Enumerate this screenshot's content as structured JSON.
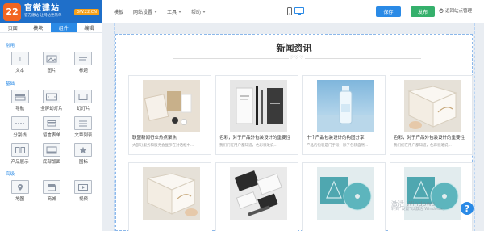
{
  "brand": {
    "logo_text": "22",
    "name": "官微建站",
    "slogan": "官方建站 让网站更简单",
    "site_badge": "GW.22.CN"
  },
  "toolbar": {
    "menu": [
      {
        "label": "模板"
      },
      {
        "label": "网站设置"
      },
      {
        "label": "工具"
      },
      {
        "label": "帮助"
      }
    ],
    "save_label": "保存",
    "publish_label": "发布",
    "back_label": "返回站点管理"
  },
  "sidebar": {
    "tabs": [
      "页面",
      "模块",
      "组件",
      "编辑"
    ],
    "active_tab": "组件",
    "groups": [
      {
        "title": "常用",
        "items": [
          "文本",
          "图片",
          "标题"
        ]
      },
      {
        "title": "基础",
        "items": [
          "导航",
          "全屏幻灯片",
          "幻灯片",
          "分割线",
          "留言表单",
          "文章列表",
          "产品展示",
          "底部版面",
          "图标"
        ]
      },
      {
        "title": "高级",
        "items": [
          "地图",
          "商城",
          "视频"
        ]
      }
    ]
  },
  "main": {
    "section_title": "新闻资讯",
    "title_deco": "♡♡♡",
    "cards": [
      {
        "title": "联盟新闻行业热点聚焦",
        "desc": "大部分服务和服务会显示在对话框中..."
      },
      {
        "title": "色彩，对于产品外包装设计的重要性",
        "desc": "我们们在用户都知道，色彩很难说..."
      },
      {
        "title": "十个产品包装设计的构图分享",
        "desc": "产品的包装是门手段，除了包装自然..."
      },
      {
        "title": "色彩，对于产品外包装设计的重要性",
        "desc": "我们们在用户都知道，色彩很难说..."
      },
      {
        "title": "",
        "desc": ""
      },
      {
        "title": "",
        "desc": ""
      },
      {
        "title": "",
        "desc": ""
      },
      {
        "title": "",
        "desc": ""
      }
    ]
  },
  "watermark": {
    "line1": "激活 Windows",
    "line2": "转到\"设置\"以激活 Windows。"
  },
  "help_label": "?"
}
